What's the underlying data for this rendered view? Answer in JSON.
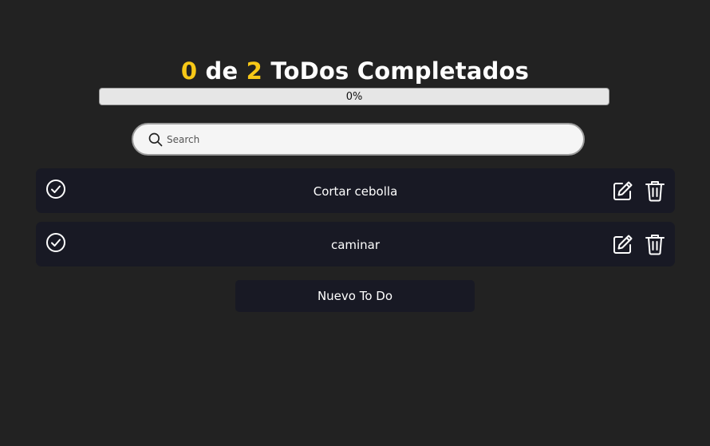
{
  "header": {
    "completed_count": "0",
    "word_of": "de",
    "total_count": "2",
    "suffix": "ToDos Completados"
  },
  "progress": {
    "value": 0,
    "label": "0%"
  },
  "search": {
    "placeholder": "Search",
    "value": ""
  },
  "todos": [
    {
      "text": "Cortar cebolla",
      "completed": false
    },
    {
      "text": "caminar",
      "completed": false
    }
  ],
  "new_button": {
    "label": "Nuevo To Do"
  },
  "icons": {
    "search": "search-icon",
    "complete": "check-circle-icon",
    "edit": "edit-icon",
    "delete": "trash-icon"
  },
  "colors": {
    "background": "#222222",
    "card": "#181924",
    "accent": "#f7c817",
    "text": "#ffffff",
    "progress_track": "#e6e6e6"
  }
}
